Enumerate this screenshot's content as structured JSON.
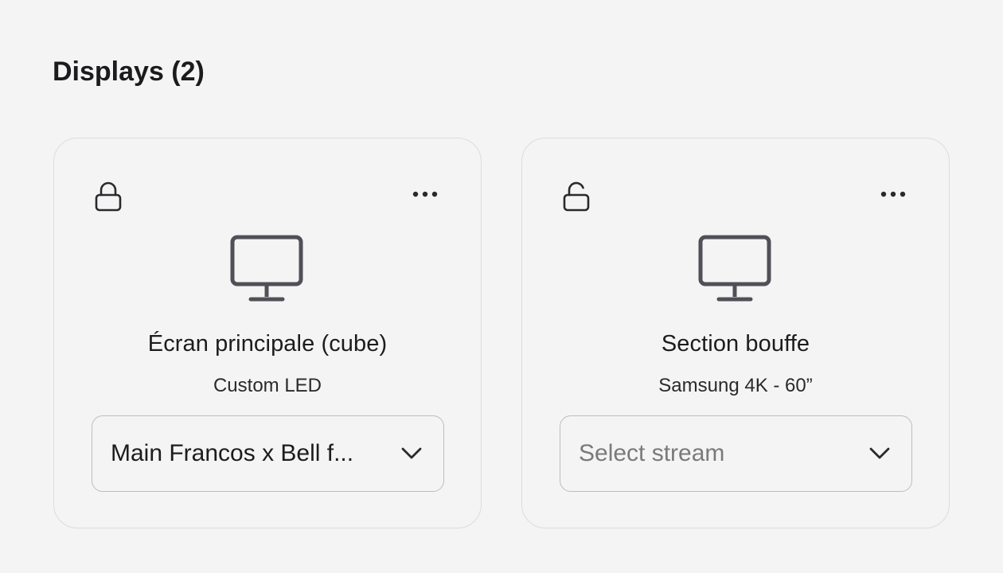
{
  "section": {
    "title": "Displays (2)"
  },
  "displays": [
    {
      "name": "Écran principale (cube)",
      "model": "Custom LED",
      "lock_icon": "lock-closed-icon",
      "stream": {
        "value": "Main Francos x Bell f...",
        "placeholder": "Select stream"
      }
    },
    {
      "name": "Section bouffe",
      "model": "Samsung 4K - 60”",
      "lock_icon": "lock-open-icon",
      "stream": {
        "value": "",
        "placeholder": "Select stream"
      }
    }
  ],
  "colors": {
    "background": "#f4f4f4",
    "card_border": "#dcdcdc",
    "icon": "#505058",
    "text": "#1c1c1e",
    "placeholder": "#7a7a7c"
  }
}
